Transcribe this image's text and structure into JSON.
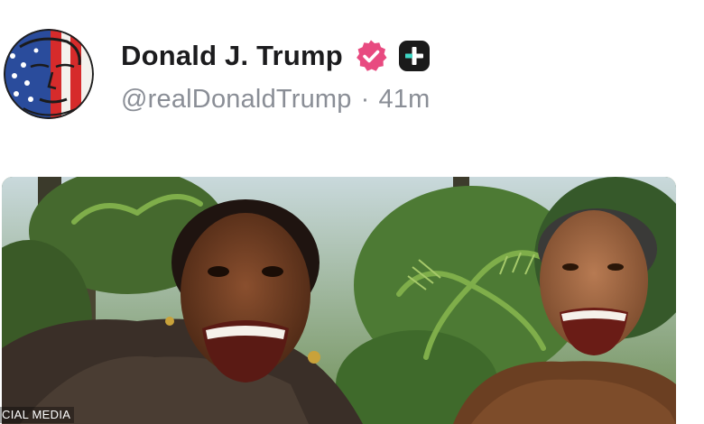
{
  "post": {
    "author": {
      "display_name": "Donald J. Trump",
      "handle": "@realDonaldTrump",
      "separator": "·",
      "timestamp": "41m",
      "avatar_icon": "flag-portrait-avatar",
      "verified_icon": "verified-badge-icon",
      "verified_color": "#e84a80",
      "plus_icon": "plus-badge-icon"
    },
    "media": {
      "watermark": "CIAL MEDIA"
    }
  },
  "colors": {
    "name_text": "#1c1c1e",
    "meta_text": "#8a8e96",
    "verified": "#e84a80",
    "plus_badge_bg": "#1a1a1a"
  }
}
